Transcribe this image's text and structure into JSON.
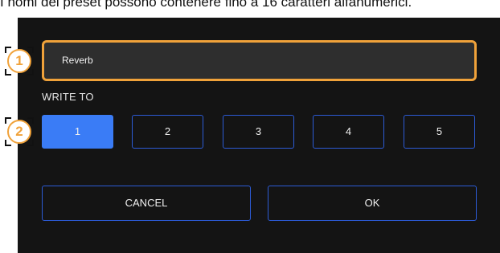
{
  "caption": "I nomi dei preset possono contenere fino a 16 caratteri alfanumerici.",
  "dialog": {
    "name_value": "Reverb",
    "write_to_label": "WRITE TO",
    "slots": [
      {
        "label": "1",
        "selected": true
      },
      {
        "label": "2",
        "selected": false
      },
      {
        "label": "3",
        "selected": false
      },
      {
        "label": "4",
        "selected": false
      },
      {
        "label": "5",
        "selected": false
      }
    ],
    "cancel_label": "CANCEL",
    "ok_label": "OK"
  },
  "callouts": [
    "1",
    "2"
  ],
  "colors": {
    "accent_orange": "#f0a23a",
    "selected_blue": "#3a7cf6",
    "button_border_blue": "#2c5bd6",
    "dialog_background": "#141414"
  }
}
